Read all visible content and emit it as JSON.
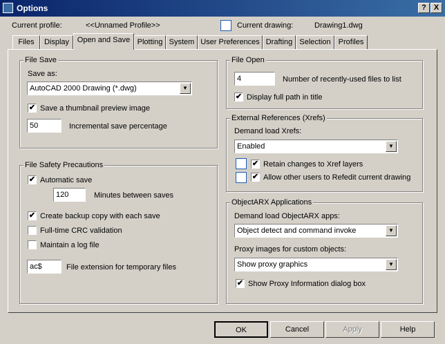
{
  "window": {
    "title": "Options"
  },
  "titlebar_buttons": {
    "help": "?",
    "close": "X"
  },
  "header": {
    "profile_label": "Current profile:",
    "profile_value": "<<Unnamed Profile>>",
    "drawing_label": "Current drawing:",
    "drawing_value": "Drawing1.dwg"
  },
  "tabs": [
    "Files",
    "Display",
    "Open and Save",
    "Plotting",
    "System",
    "User Preferences",
    "Drafting",
    "Selection",
    "Profiles"
  ],
  "file_save": {
    "title": "File Save",
    "save_as_label": "Save as:",
    "save_as_value": "AutoCAD 2000 Drawing (*.dwg)",
    "thumbnail_label": "Save a thumbnail preview image",
    "incremental_value": "50",
    "incremental_label": "Incremental save percentage"
  },
  "file_safety": {
    "title": "File Safety Precautions",
    "autosave_label": "Automatic save",
    "minutes_value": "120",
    "minutes_label": "Minutes between saves",
    "backup_label": "Create backup copy with each save",
    "crc_label": "Full-time CRC validation",
    "log_label": "Maintain a log file",
    "ext_value": "ac$",
    "ext_label": "File extension for temporary files"
  },
  "file_open": {
    "title": "File Open",
    "recent_value": "4",
    "recent_label": "Number of recently-used files to list",
    "fullpath_label": "Display full path in title"
  },
  "xrefs": {
    "title": "External References (Xrefs)",
    "demand_label": "Demand load Xrefs:",
    "demand_value": "Enabled",
    "retain_label": "Retain changes to Xref layers",
    "refedit_label": "Allow other users to Refedit current drawing"
  },
  "objectarx": {
    "title": "ObjectARX Applications",
    "demand_label": "Demand load ObjectARX apps:",
    "demand_value": "Object detect and command invoke",
    "proxy_label": "Proxy images for custom objects:",
    "proxy_value": "Show proxy graphics",
    "proxyinfo_label": "Show Proxy Information dialog box"
  },
  "buttons": {
    "ok": "OK",
    "cancel": "Cancel",
    "apply": "Apply",
    "help": "Help"
  },
  "checkbox_states": {
    "thumbnail": true,
    "autosave": true,
    "backup": true,
    "crc": false,
    "log": false,
    "fullpath": true,
    "retain": true,
    "refedit": true,
    "proxyinfo": true
  },
  "check_glyph": "✔"
}
